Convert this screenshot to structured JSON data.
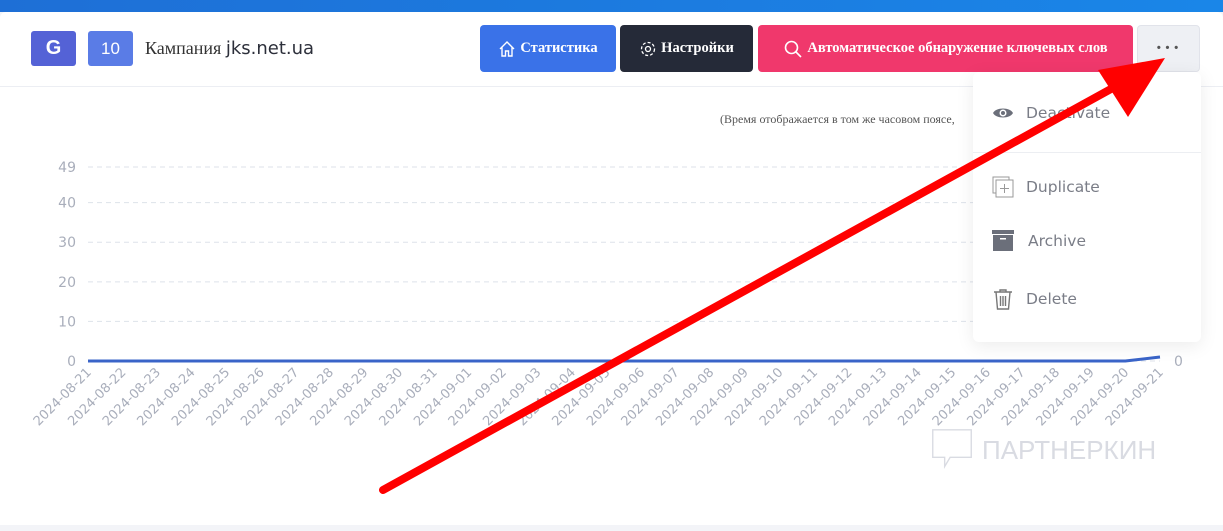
{
  "header": {
    "g_badge": "G",
    "count_badge": "10",
    "title_prefix": "Кампания",
    "title_domain": "jks.net.ua"
  },
  "toolbar": {
    "stats": "Статистика",
    "settings": "Настройки",
    "auto_keywords": "Автоматическое обнаружение ключевых слов",
    "more": "···"
  },
  "timezone_note": "(Время отображается в том же часовом поясе,",
  "menu": {
    "items": [
      {
        "label": "Deactivate",
        "icon": "eye-icon"
      },
      {
        "label": "Duplicate",
        "icon": "duplicate-icon"
      },
      {
        "label": "Archive",
        "icon": "archive-icon"
      },
      {
        "label": "Delete",
        "icon": "trash-icon"
      }
    ]
  },
  "watermark": "ПАРТНЕРКИН",
  "colors": {
    "primary": "#3a72e8",
    "dark": "#252a38",
    "accent": "#f0386c",
    "line": "#3a64c8",
    "annotation_arrow": "#ff0000"
  },
  "chart_data": {
    "type": "line",
    "x": [
      "2024-08-21",
      "2024-08-22",
      "2024-08-23",
      "2024-08-24",
      "2024-08-25",
      "2024-08-26",
      "2024-08-27",
      "2024-08-28",
      "2024-08-29",
      "2024-08-30",
      "2024-08-31",
      "2024-09-01",
      "2024-09-02",
      "2024-09-03",
      "2024-09-04",
      "2024-09-05",
      "2024-09-06",
      "2024-09-07",
      "2024-09-08",
      "2024-09-09",
      "2024-09-10",
      "2024-09-11",
      "2024-09-12",
      "2024-09-13",
      "2024-09-14",
      "2024-09-15",
      "2024-09-16",
      "2024-09-17",
      "2024-09-18",
      "2024-09-19",
      "2024-09-20",
      "2024-09-21"
    ],
    "values": [
      0,
      0,
      0,
      0,
      0,
      0,
      0,
      0,
      0,
      0,
      0,
      0,
      0,
      0,
      0,
      0,
      0,
      0,
      0,
      0,
      0,
      0,
      0,
      0,
      0,
      0,
      0,
      0,
      0,
      0,
      0,
      1
    ],
    "y_ticks": [
      "0",
      "10",
      "20",
      "30",
      "40",
      "49"
    ],
    "ylim": [
      0,
      49
    ],
    "right_axis_ticks": [
      "0"
    ],
    "grid": true
  }
}
